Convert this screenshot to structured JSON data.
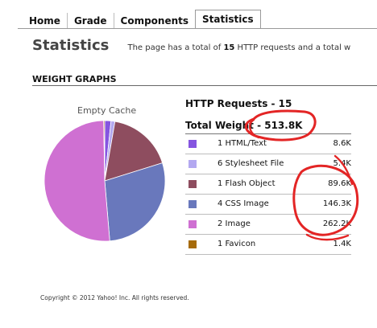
{
  "tabs": [
    {
      "label": "Home",
      "active": false
    },
    {
      "label": "Grade",
      "active": false
    },
    {
      "label": "Components",
      "active": false
    },
    {
      "label": "Statistics",
      "active": true
    }
  ],
  "header": {
    "title": "Statistics",
    "summary_prefix": "The page has a total of",
    "summary_count": "15",
    "summary_suffix": "HTTP requests and a total w"
  },
  "weight_graphs": {
    "heading": "WEIGHT GRAPHS",
    "pie_label": "Empty Cache",
    "requests_line": "HTTP Requests - 15",
    "weight_line": "Total Weight - 513.8K",
    "rows": [
      {
        "label": "1 HTML/Text",
        "size": "8.6K",
        "color": "#8555e0"
      },
      {
        "label": "6 Stylesheet File",
        "size": "5.4K",
        "color": "#b3a8f0"
      },
      {
        "label": "1 Flash Object",
        "size": "89.6K",
        "color": "#8e4d5f"
      },
      {
        "label": "4 CSS Image",
        "size": "146.3K",
        "color": "#6978bc"
      },
      {
        "label": "2 Image",
        "size": "262.2K",
        "color": "#cf70d2"
      },
      {
        "label": "1 Favicon",
        "size": "1.4K",
        "color": "#a66b0a"
      }
    ]
  },
  "chart_data": {
    "type": "pie",
    "title": "Empty Cache",
    "categories": [
      "HTML/Text",
      "Stylesheet File",
      "Flash Object",
      "CSS Image",
      "Image",
      "Favicon"
    ],
    "values": [
      8.6,
      5.4,
      89.6,
      146.3,
      262.2,
      1.4
    ],
    "units": "K",
    "colors": [
      "#8555e0",
      "#b3a8f0",
      "#8e4d5f",
      "#6978bc",
      "#cf70d2",
      "#a66b0a"
    ]
  },
  "footer": {
    "copyright": "Copyright © 2012 Yahoo! Inc. All rights reserved."
  }
}
